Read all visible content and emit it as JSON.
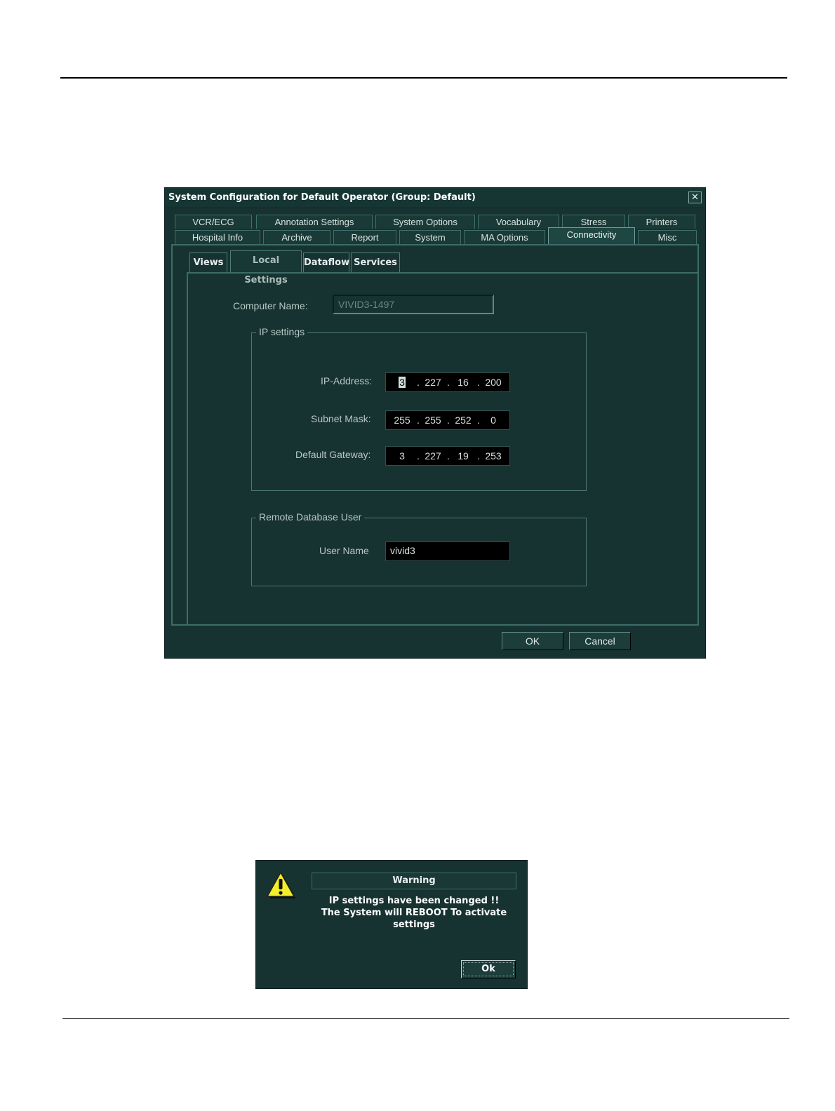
{
  "dialog": {
    "title": "System Configuration for Default Operator (Group: Default)",
    "close_glyph": "✕",
    "tabs_row1": [
      "VCR/ECG",
      "Annotation Settings",
      "System Options",
      "Vocabulary",
      "Stress",
      "Printers"
    ],
    "tabs_row2": [
      "Hospital Info",
      "Archive",
      "Report",
      "System",
      "MA Options",
      "Connectivity",
      "Misc"
    ],
    "active_tab": "Connectivity",
    "subtabs": [
      "Views",
      "Local Settings",
      "Dataflow",
      "Services"
    ],
    "active_subtab": "Local Settings",
    "computer_name_label": "Computer Name:",
    "computer_name_value": "VIVID3-1497",
    "ip_group_title": "IP settings",
    "ip_address_label": "IP-Address:",
    "ip_address": [
      "3",
      "227",
      "16",
      "200"
    ],
    "subnet_label": "Subnet Mask:",
    "subnet_mask": [
      "255",
      "255",
      "252",
      "0"
    ],
    "gateway_label": "Default Gateway:",
    "gateway": [
      "3",
      "227",
      "19",
      "253"
    ],
    "ip_separator": ".",
    "remote_group_title": "Remote Database User",
    "user_name_label": "User Name",
    "user_name_value": "vivid3",
    "ok_label": "OK",
    "cancel_label": "Cancel"
  },
  "warning": {
    "title": "Warning",
    "line1": "IP settings have been changed !!",
    "line2": "The System will REBOOT To activate",
    "line3": "settings",
    "ok_label": "Ok",
    "icon": "warning-triangle-icon",
    "icon_color": "#f2ef2a"
  }
}
